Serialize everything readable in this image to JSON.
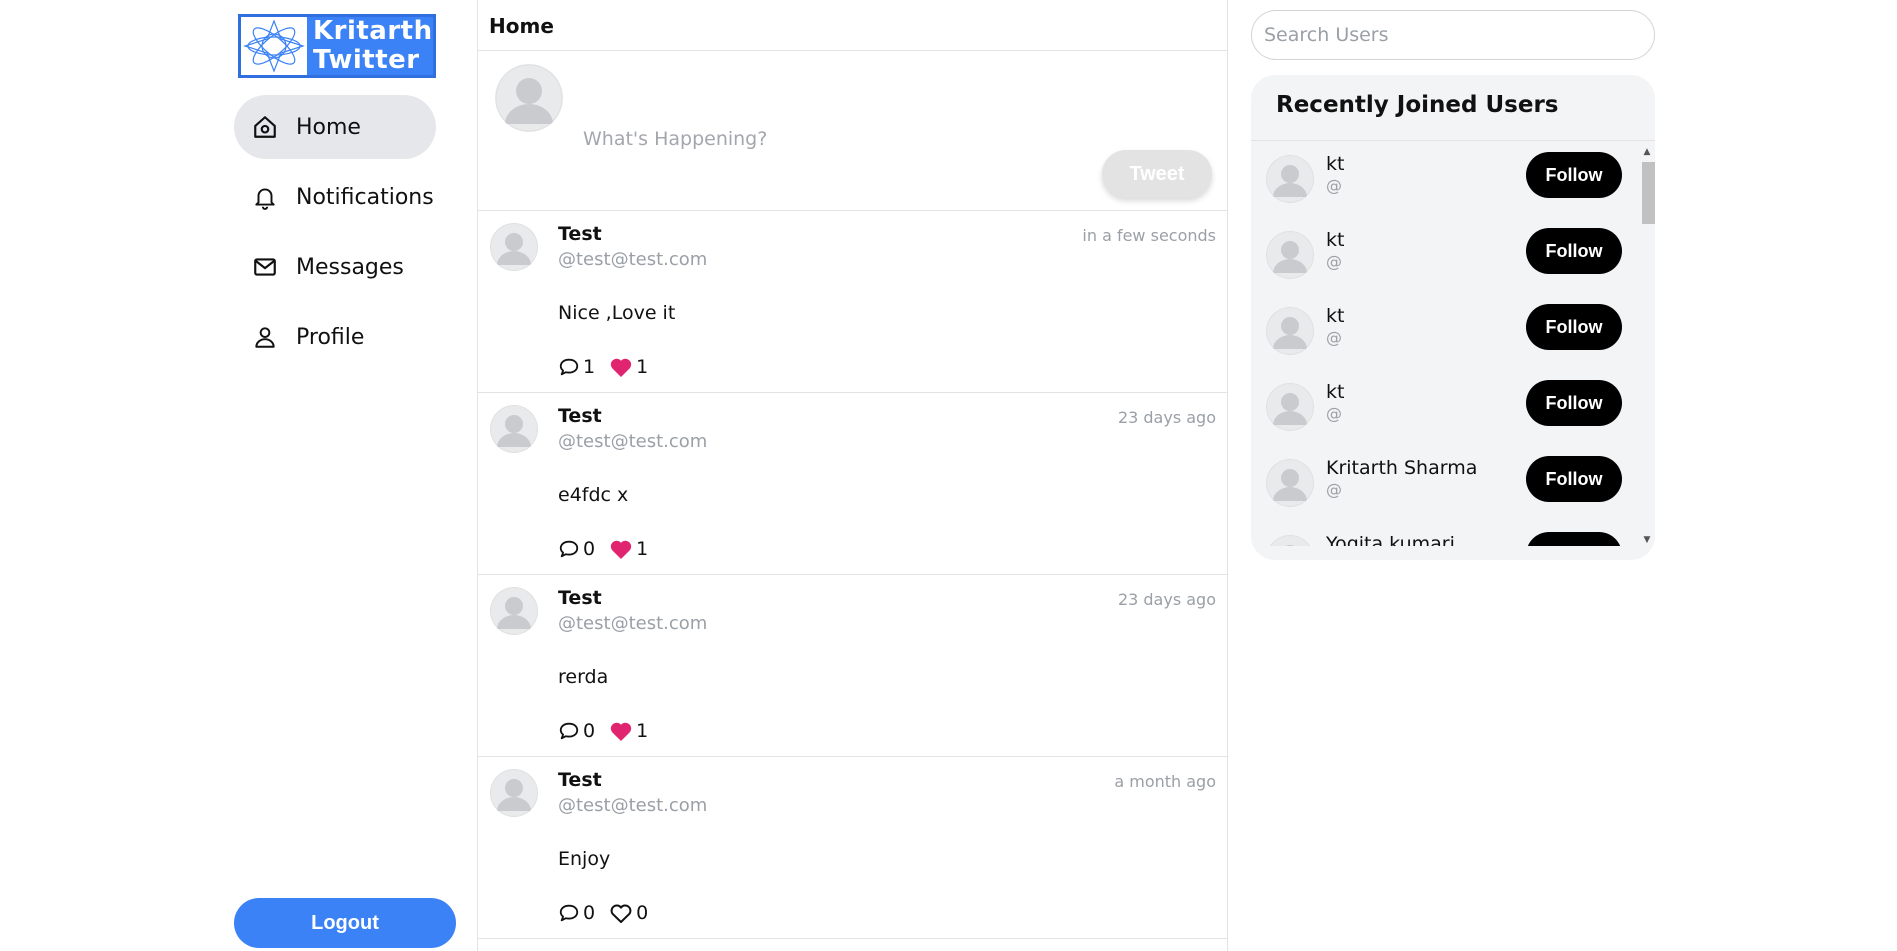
{
  "logo": {
    "line1": "Kritarth",
    "line2": "Twitter"
  },
  "nav": [
    {
      "label": "Home",
      "icon": "home-icon",
      "active": true
    },
    {
      "label": "Notifications",
      "icon": "bell-icon",
      "active": false
    },
    {
      "label": "Messages",
      "icon": "mail-icon",
      "active": false
    },
    {
      "label": "Profile",
      "icon": "user-icon",
      "active": false
    }
  ],
  "logout_label": "Logout",
  "main": {
    "title": "Home",
    "compose_placeholder": "What's Happening?",
    "tweet_button": "Tweet"
  },
  "tweets": [
    {
      "name": "Test",
      "handle": "@test@test.com",
      "time": "in a few seconds",
      "body": "Nice ,Love it",
      "comments": "1",
      "likes": "1",
      "liked": true
    },
    {
      "name": "Test",
      "handle": "@test@test.com",
      "time": "23 days ago",
      "body": "e4fdc x",
      "comments": "0",
      "likes": "1",
      "liked": true
    },
    {
      "name": "Test",
      "handle": "@test@test.com",
      "time": "23 days ago",
      "body": "rerda",
      "comments": "0",
      "likes": "1",
      "liked": true
    },
    {
      "name": "Test",
      "handle": "@test@test.com",
      "time": "a month ago",
      "body": "Enjoy",
      "comments": "0",
      "likes": "0",
      "liked": false
    }
  ],
  "search_placeholder": "Search Users",
  "recent": {
    "title": "Recently Joined Users",
    "follow_label": "Follow",
    "users": [
      {
        "name": "kt",
        "handle": "@"
      },
      {
        "name": "kt",
        "handle": "@"
      },
      {
        "name": "kt",
        "handle": "@"
      },
      {
        "name": "kt",
        "handle": "@"
      },
      {
        "name": "Kritarth Sharma",
        "handle": "@"
      },
      {
        "name": "Yogita kumari",
        "handle": "@"
      }
    ]
  },
  "colors": {
    "accent": "#3b82f6",
    "like": "#e0246f",
    "follow_bg": "#000000",
    "muted": "#9aa0a6"
  }
}
